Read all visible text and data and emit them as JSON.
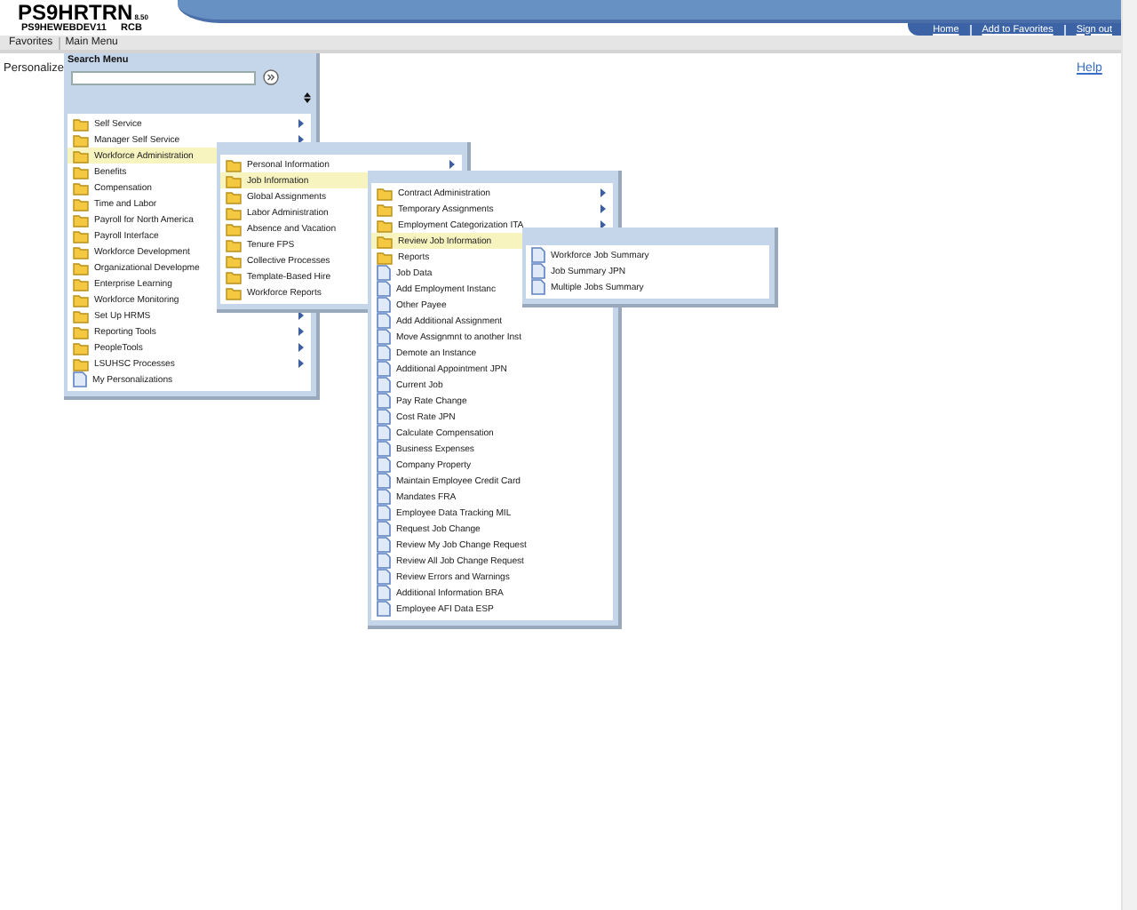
{
  "header": {
    "app_name": "PS9HRTRN",
    "version": "8.50",
    "server": "PS9HEWEBDEV11",
    "user": "RCB"
  },
  "top_links": [
    "Home",
    "Add to Favorites",
    "Sign out"
  ],
  "menubar": [
    {
      "label": "Favorites"
    },
    {
      "label": "Main Menu"
    }
  ],
  "page": {
    "personalize": "Personalize",
    "help": "Help"
  },
  "search_menu": {
    "title": "Search Menu"
  },
  "menus": [
    {
      "items": [
        {
          "label": "Self Service",
          "kind": "folder",
          "submenu": true,
          "selected": false
        },
        {
          "label": "Manager Self Service",
          "kind": "folder",
          "submenu": true,
          "selected": false
        },
        {
          "label": "Workforce Administration",
          "kind": "folder",
          "selected": true
        },
        {
          "label": "Benefits",
          "kind": "folder",
          "selected": false
        },
        {
          "label": "Compensation",
          "kind": "folder",
          "selected": false
        },
        {
          "label": "Time and Labor",
          "kind": "folder",
          "selected": false
        },
        {
          "label": "Payroll for North America",
          "kind": "folder",
          "selected": false
        },
        {
          "label": "Payroll Interface",
          "kind": "folder",
          "selected": false
        },
        {
          "label": "Workforce Development",
          "kind": "folder",
          "selected": false
        },
        {
          "label": "Organizational Developme",
          "kind": "folder",
          "selected": false
        },
        {
          "label": "Enterprise Learning",
          "kind": "folder",
          "selected": false
        },
        {
          "label": "Workforce Monitoring",
          "kind": "folder",
          "selected": false
        },
        {
          "label": "Set Up HRMS",
          "kind": "folder",
          "submenu": true,
          "selected": false
        },
        {
          "label": "Reporting Tools",
          "kind": "folder",
          "submenu": true,
          "selected": false
        },
        {
          "label": "PeopleTools",
          "kind": "folder",
          "submenu": true,
          "selected": false
        },
        {
          "label": "LSUHSC Processes",
          "kind": "folder",
          "submenu": true,
          "selected": false
        },
        {
          "label": "My Personalizations",
          "kind": "page",
          "submenu": false,
          "selected": false
        }
      ]
    },
    {
      "items": [
        {
          "label": "Personal Information",
          "kind": "folder",
          "submenu": true,
          "selected": false
        },
        {
          "label": "Job Information",
          "kind": "folder",
          "selected": true
        },
        {
          "label": "Global Assignments",
          "kind": "folder",
          "selected": false
        },
        {
          "label": "Labor Administration",
          "kind": "folder",
          "selected": false
        },
        {
          "label": "Absence and Vacation",
          "kind": "folder",
          "selected": false
        },
        {
          "label": "Tenure FPS",
          "kind": "folder",
          "selected": false
        },
        {
          "label": "Collective Processes",
          "kind": "folder",
          "selected": false
        },
        {
          "label": "Template-Based Hire",
          "kind": "folder",
          "selected": false
        },
        {
          "label": "Workforce Reports",
          "kind": "folder",
          "selected": false
        }
      ]
    },
    {
      "items": [
        {
          "label": "Contract Administration",
          "kind": "folder",
          "submenu": true,
          "selected": false
        },
        {
          "label": "Temporary Assignments",
          "kind": "folder",
          "submenu": true,
          "selected": false
        },
        {
          "label": "Employment Categorization ITA",
          "kind": "folder",
          "submenu": true,
          "selected": false
        },
        {
          "label": "Review Job Information",
          "kind": "folder",
          "selected": true
        },
        {
          "label": "Reports",
          "kind": "folder",
          "selected": false
        },
        {
          "label": "Job Data",
          "kind": "page",
          "selected": false
        },
        {
          "label": "Add Employment Instanc",
          "kind": "page",
          "selected": false
        },
        {
          "label": "Other Payee",
          "kind": "page",
          "submenu": false,
          "selected": false
        },
        {
          "label": "Add Additional Assignment",
          "kind": "page",
          "submenu": false,
          "selected": false
        },
        {
          "label": "Move Assignmnt to another Inst",
          "kind": "page",
          "submenu": false,
          "selected": false
        },
        {
          "label": "Demote an Instance",
          "kind": "page",
          "submenu": false,
          "selected": false
        },
        {
          "label": "Additional Appointment JPN",
          "kind": "page",
          "submenu": false,
          "selected": false
        },
        {
          "label": "Current Job",
          "kind": "page",
          "submenu": false,
          "selected": false
        },
        {
          "label": "Pay Rate Change",
          "kind": "page",
          "submenu": false,
          "selected": false
        },
        {
          "label": "Cost Rate JPN",
          "kind": "page",
          "submenu": false,
          "selected": false
        },
        {
          "label": "Calculate Compensation",
          "kind": "page",
          "submenu": false,
          "selected": false
        },
        {
          "label": "Business Expenses",
          "kind": "page",
          "submenu": false,
          "selected": false
        },
        {
          "label": "Company Property",
          "kind": "page",
          "submenu": false,
          "selected": false
        },
        {
          "label": "Maintain Employee Credit Card",
          "kind": "page",
          "submenu": false,
          "selected": false
        },
        {
          "label": "Mandates FRA",
          "kind": "page",
          "submenu": false,
          "selected": false
        },
        {
          "label": "Employee Data Tracking MIL",
          "kind": "page",
          "submenu": false,
          "selected": false
        },
        {
          "label": "Request Job Change",
          "kind": "page",
          "submenu": false,
          "selected": false
        },
        {
          "label": "Review My Job Change Request",
          "kind": "page",
          "submenu": false,
          "selected": false
        },
        {
          "label": "Review All Job Change Request",
          "kind": "page",
          "submenu": false,
          "selected": false
        },
        {
          "label": "Review Errors and Warnings",
          "kind": "page",
          "submenu": false,
          "selected": false
        },
        {
          "label": "Additional Information BRA",
          "kind": "page",
          "submenu": false,
          "selected": false
        },
        {
          "label": "Employee AFI Data ESP",
          "kind": "page",
          "submenu": false,
          "selected": false
        }
      ]
    },
    {
      "items": [
        {
          "label": "Workforce Job Summary",
          "kind": "page",
          "submenu": false,
          "selected": false
        },
        {
          "label": "Job Summary JPN",
          "kind": "page",
          "submenu": false,
          "selected": false
        },
        {
          "label": "Multiple Jobs Summary",
          "kind": "page",
          "submenu": false,
          "selected": false
        }
      ]
    }
  ]
}
